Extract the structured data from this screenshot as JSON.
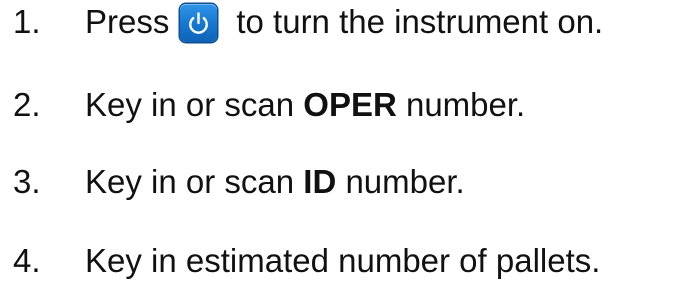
{
  "steps": [
    {
      "number": "1.",
      "text_before": "Press",
      "icon": "power-icon",
      "text_after": "to turn the instrument on."
    },
    {
      "number": "2.",
      "text_before": "Key in or scan ",
      "bold": "OPER",
      "text_after": " number."
    },
    {
      "number": "3.",
      "text_before": "Key in or scan ",
      "bold": "ID",
      "text_after": " number."
    },
    {
      "number": "4.",
      "text": "Key in estimated number of pallets."
    }
  ],
  "colors": {
    "power_button": "#1a7ad6",
    "text": "#111111"
  }
}
